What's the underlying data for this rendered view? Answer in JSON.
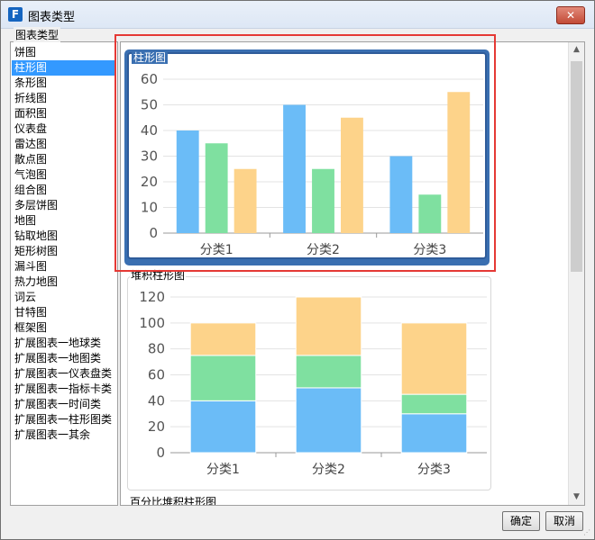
{
  "window": {
    "title": "图表类型",
    "app_icon_glyph": "F",
    "close_glyph": "✕"
  },
  "group_label": "图表类型",
  "chart_types": [
    "饼图",
    "柱形图",
    "条形图",
    "折线图",
    "面积图",
    "仪表盘",
    "雷达图",
    "散点图",
    "气泡图",
    "组合图",
    "多层饼图",
    "地图",
    "钻取地图",
    "矩形树图",
    "漏斗图",
    "热力地图",
    "词云",
    "甘特图",
    "框架图",
    "扩展图表一地球类",
    "扩展图表一地图类",
    "扩展图表一仪表盘类",
    "扩展图表一指标卡类",
    "扩展图表一时间类",
    "扩展图表一柱形图类",
    "扩展图表一其余"
  ],
  "selected_index": 1,
  "previews": [
    {
      "title": "柱形图"
    },
    {
      "title": "堆积柱形图"
    },
    {
      "title": "百分比堆积柱形图"
    }
  ],
  "colors": {
    "blue": "#6bbcf7",
    "green": "#7fe0a0",
    "orange": "#fdd38a",
    "selection": "#3399ff",
    "highlight": "#e53935"
  },
  "chart_data": [
    {
      "type": "bar",
      "categories": [
        "分类1",
        "分类2",
        "分类3"
      ],
      "series": [
        {
          "values": [
            40,
            50,
            30
          ]
        },
        {
          "values": [
            35,
            25,
            15
          ]
        },
        {
          "values": [
            25,
            45,
            55
          ]
        }
      ],
      "ylim": [
        0,
        60
      ],
      "yticks": [
        0,
        10,
        20,
        30,
        40,
        50,
        60
      ]
    },
    {
      "type": "bar",
      "stacked": true,
      "categories": [
        "分类1",
        "分类2",
        "分类3"
      ],
      "series": [
        {
          "values": [
            40,
            50,
            30
          ]
        },
        {
          "values": [
            35,
            25,
            15
          ]
        },
        {
          "values": [
            25,
            45,
            55
          ]
        }
      ],
      "ylim": [
        0,
        120
      ],
      "yticks": [
        0,
        20,
        40,
        60,
        80,
        100,
        120
      ]
    }
  ],
  "buttons": {
    "ok": "确定",
    "cancel": "取消"
  },
  "scroll": {
    "up_glyph": "▲",
    "down_glyph": "▼"
  },
  "grip_glyph": "⋰"
}
